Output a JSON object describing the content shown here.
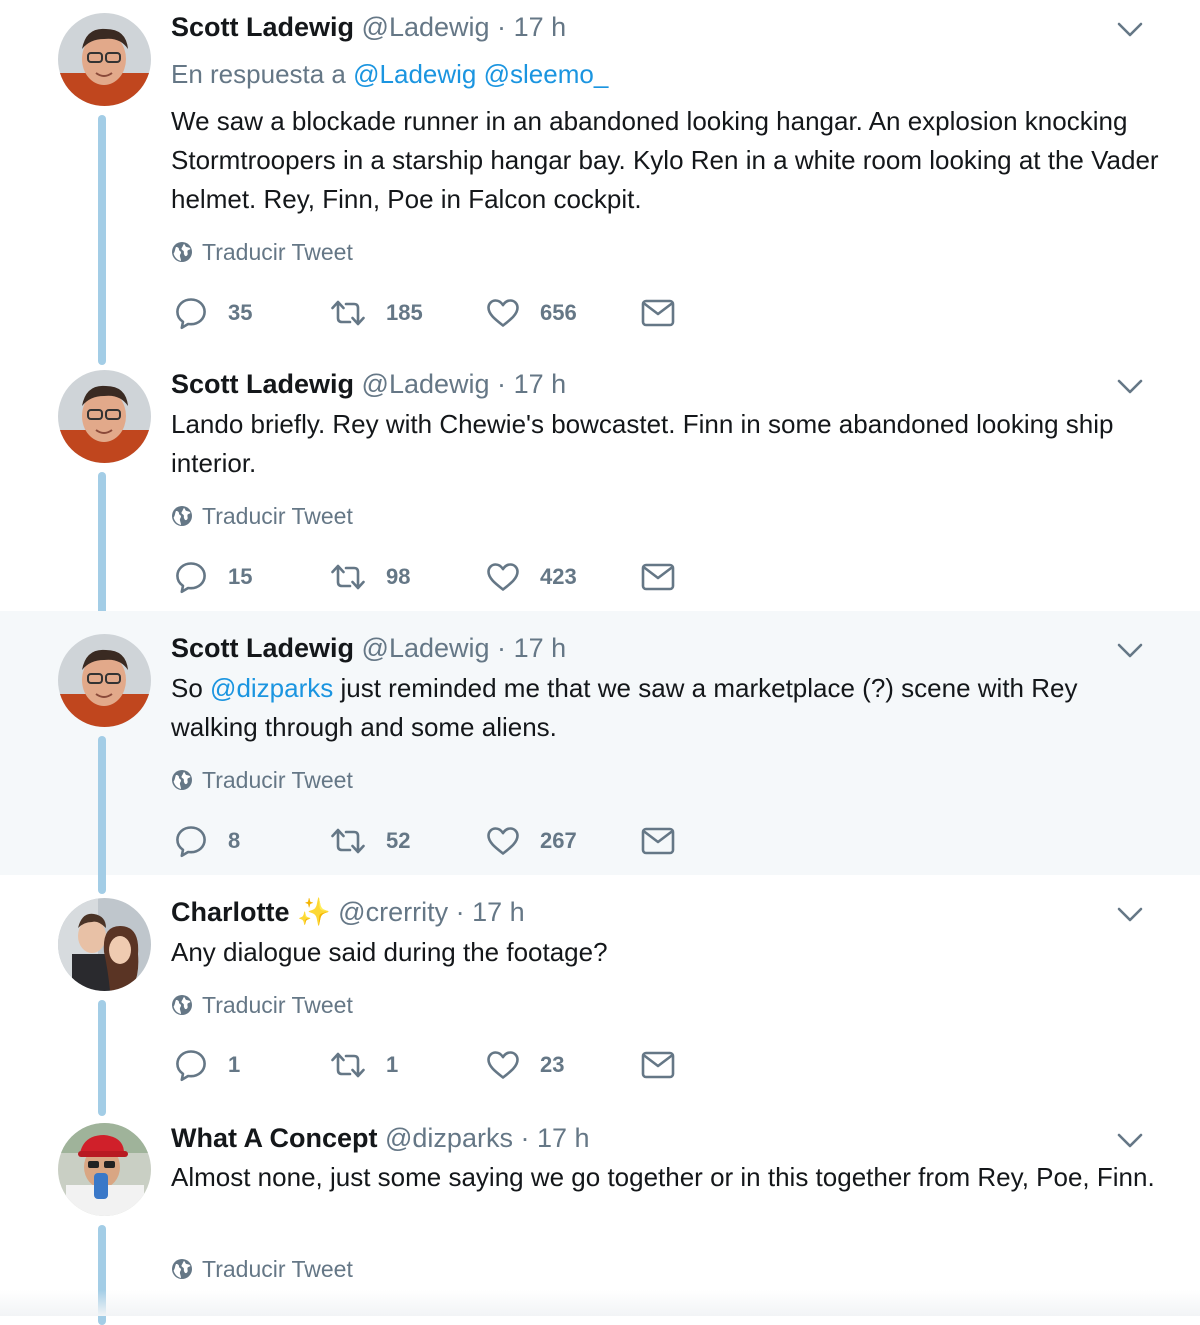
{
  "colors": {
    "accent": "#1b95e0",
    "muted": "#657786",
    "thread_line": "#a3cde6",
    "highlight_bg": "#f5f8fa"
  },
  "translate_label": "Traducir Tweet",
  "tweets": [
    {
      "name": "Scott Ladewig",
      "handle": "@Ladewig",
      "dot": "·",
      "time": "17 h",
      "reply_prefix": "En respuesta a",
      "reply_mention_1": "@Ladewig",
      "reply_mention_2": "@sleemo_",
      "text": "We saw a blockade runner in an abandoned looking hangar. An explosion knocking Stormtroopers in a starship hangar bay. Kylo Ren in a white room looking at the Vader helmet. Rey, Finn, Poe in Falcon cockpit.",
      "replies": "35",
      "retweets": "185",
      "likes": "656"
    },
    {
      "name": "Scott Ladewig",
      "handle": "@Ladewig",
      "dot": "·",
      "time": "17 h",
      "text": "Lando briefly. Rey with Chewie's bowcastet. Finn in some abandoned looking ship interior.",
      "replies": "15",
      "retweets": "98",
      "likes": "423"
    },
    {
      "name": "Scott Ladewig",
      "handle": "@Ladewig",
      "dot": "·",
      "time": "17 h",
      "text_before": "So",
      "mention": "@dizparks",
      "text_after": "just reminded me that we saw a marketplace (?) scene with Rey walking through and some aliens.",
      "replies": "8",
      "retweets": "52",
      "likes": "267"
    },
    {
      "name": "Charlotte",
      "name_emoji": "✨",
      "handle": "@crerrity",
      "dot": "·",
      "time": "17 h",
      "text": "Any dialogue said during the footage?",
      "replies": "1",
      "retweets": "1",
      "likes": "23"
    },
    {
      "name": "What A Concept",
      "handle": "@dizparks",
      "dot": "·",
      "time": "17 h",
      "text": "Almost none, just some saying we go together or in this together from Rey, Poe, Finn."
    }
  ]
}
